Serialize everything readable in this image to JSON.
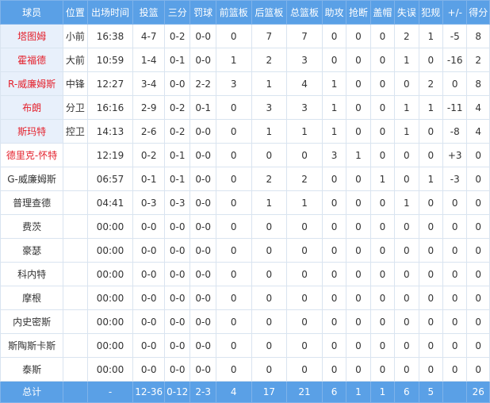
{
  "header": {
    "columns": [
      "球员",
      "位置",
      "出场时间",
      "投篮",
      "三分",
      "罚球",
      "前篮板",
      "后篮板",
      "总篮板",
      "助攻",
      "抢断",
      "盖帽",
      "失误",
      "犯规",
      "+/-",
      "得分"
    ]
  },
  "colors": {
    "header_bg": "#5aa0e6",
    "starter_name_bg": "#e8f0fb",
    "highlight_name": "#e4212d"
  },
  "rows": [
    {
      "name": "塔图姆",
      "pos": "小前",
      "min": "16:38",
      "fg": "4-7",
      "tp": "0-2",
      "ft": "0-0",
      "oreb": "0",
      "dreb": "7",
      "reb": "7",
      "ast": "0",
      "stl": "0",
      "blk": "0",
      "tov": "2",
      "pf": "1",
      "pm": "-5",
      "pts": "8",
      "starter": true,
      "highlight": true
    },
    {
      "name": "霍福德",
      "pos": "大前",
      "min": "10:59",
      "fg": "1-4",
      "tp": "0-1",
      "ft": "0-0",
      "oreb": "1",
      "dreb": "2",
      "reb": "3",
      "ast": "0",
      "stl": "0",
      "blk": "0",
      "tov": "1",
      "pf": "0",
      "pm": "-16",
      "pts": "2",
      "starter": true,
      "highlight": true
    },
    {
      "name": "R-威廉姆斯",
      "pos": "中锋",
      "min": "12:27",
      "fg": "3-4",
      "tp": "0-0",
      "ft": "2-2",
      "oreb": "3",
      "dreb": "1",
      "reb": "4",
      "ast": "1",
      "stl": "0",
      "blk": "0",
      "tov": "0",
      "pf": "2",
      "pm": "0",
      "pts": "8",
      "starter": true,
      "highlight": false
    },
    {
      "name": "布朗",
      "pos": "分卫",
      "min": "16:16",
      "fg": "2-9",
      "tp": "0-2",
      "ft": "0-1",
      "oreb": "0",
      "dreb": "3",
      "reb": "3",
      "ast": "1",
      "stl": "0",
      "blk": "0",
      "tov": "1",
      "pf": "1",
      "pm": "-11",
      "pts": "4",
      "starter": true,
      "highlight": true
    },
    {
      "name": "斯玛特",
      "pos": "控卫",
      "min": "14:13",
      "fg": "2-6",
      "tp": "0-2",
      "ft": "0-0",
      "oreb": "0",
      "dreb": "1",
      "reb": "1",
      "ast": "1",
      "stl": "0",
      "blk": "0",
      "tov": "1",
      "pf": "0",
      "pm": "-8",
      "pts": "4",
      "starter": true,
      "highlight": true
    },
    {
      "name": "德里克-怀特",
      "pos": "",
      "min": "12:19",
      "fg": "0-2",
      "tp": "0-1",
      "ft": "0-0",
      "oreb": "0",
      "dreb": "0",
      "reb": "0",
      "ast": "3",
      "stl": "1",
      "blk": "0",
      "tov": "0",
      "pf": "0",
      "pm": "+3",
      "pts": "0",
      "starter": false,
      "highlight": true
    },
    {
      "name": "G-威廉姆斯",
      "pos": "",
      "min": "06:57",
      "fg": "0-1",
      "tp": "0-1",
      "ft": "0-0",
      "oreb": "0",
      "dreb": "2",
      "reb": "2",
      "ast": "0",
      "stl": "0",
      "blk": "1",
      "tov": "0",
      "pf": "1",
      "pm": "-3",
      "pts": "0",
      "starter": false,
      "highlight": false
    },
    {
      "name": "普理查德",
      "pos": "",
      "min": "04:41",
      "fg": "0-3",
      "tp": "0-3",
      "ft": "0-0",
      "oreb": "0",
      "dreb": "1",
      "reb": "1",
      "ast": "0",
      "stl": "0",
      "blk": "0",
      "tov": "1",
      "pf": "0",
      "pm": "0",
      "pts": "0",
      "starter": false,
      "highlight": false
    },
    {
      "name": "费茨",
      "pos": "",
      "min": "00:00",
      "fg": "0-0",
      "tp": "0-0",
      "ft": "0-0",
      "oreb": "0",
      "dreb": "0",
      "reb": "0",
      "ast": "0",
      "stl": "0",
      "blk": "0",
      "tov": "0",
      "pf": "0",
      "pm": "0",
      "pts": "0",
      "starter": false,
      "highlight": false
    },
    {
      "name": "豪瑟",
      "pos": "",
      "min": "00:00",
      "fg": "0-0",
      "tp": "0-0",
      "ft": "0-0",
      "oreb": "0",
      "dreb": "0",
      "reb": "0",
      "ast": "0",
      "stl": "0",
      "blk": "0",
      "tov": "0",
      "pf": "0",
      "pm": "0",
      "pts": "0",
      "starter": false,
      "highlight": false
    },
    {
      "name": "科内特",
      "pos": "",
      "min": "00:00",
      "fg": "0-0",
      "tp": "0-0",
      "ft": "0-0",
      "oreb": "0",
      "dreb": "0",
      "reb": "0",
      "ast": "0",
      "stl": "0",
      "blk": "0",
      "tov": "0",
      "pf": "0",
      "pm": "0",
      "pts": "0",
      "starter": false,
      "highlight": false
    },
    {
      "name": "摩根",
      "pos": "",
      "min": "00:00",
      "fg": "0-0",
      "tp": "0-0",
      "ft": "0-0",
      "oreb": "0",
      "dreb": "0",
      "reb": "0",
      "ast": "0",
      "stl": "0",
      "blk": "0",
      "tov": "0",
      "pf": "0",
      "pm": "0",
      "pts": "0",
      "starter": false,
      "highlight": false
    },
    {
      "name": "内史密斯",
      "pos": "",
      "min": "00:00",
      "fg": "0-0",
      "tp": "0-0",
      "ft": "0-0",
      "oreb": "0",
      "dreb": "0",
      "reb": "0",
      "ast": "0",
      "stl": "0",
      "blk": "0",
      "tov": "0",
      "pf": "0",
      "pm": "0",
      "pts": "0",
      "starter": false,
      "highlight": false
    },
    {
      "name": "斯陶斯卡斯",
      "pos": "",
      "min": "00:00",
      "fg": "0-0",
      "tp": "0-0",
      "ft": "0-0",
      "oreb": "0",
      "dreb": "0",
      "reb": "0",
      "ast": "0",
      "stl": "0",
      "blk": "0",
      "tov": "0",
      "pf": "0",
      "pm": "0",
      "pts": "0",
      "starter": false,
      "highlight": false
    },
    {
      "name": "泰斯",
      "pos": "",
      "min": "00:00",
      "fg": "0-0",
      "tp": "0-0",
      "ft": "0-0",
      "oreb": "0",
      "dreb": "0",
      "reb": "0",
      "ast": "0",
      "stl": "0",
      "blk": "0",
      "tov": "0",
      "pf": "0",
      "pm": "0",
      "pts": "0",
      "starter": false,
      "highlight": false
    }
  ],
  "totals": {
    "label": "总计",
    "pos": "",
    "min": "-",
    "fg": "12-36",
    "tp": "0-12",
    "ft": "2-3",
    "oreb": "4",
    "dreb": "17",
    "reb": "21",
    "ast": "6",
    "stl": "1",
    "blk": "1",
    "tov": "6",
    "pf": "5",
    "pm": "",
    "pts": "26"
  }
}
